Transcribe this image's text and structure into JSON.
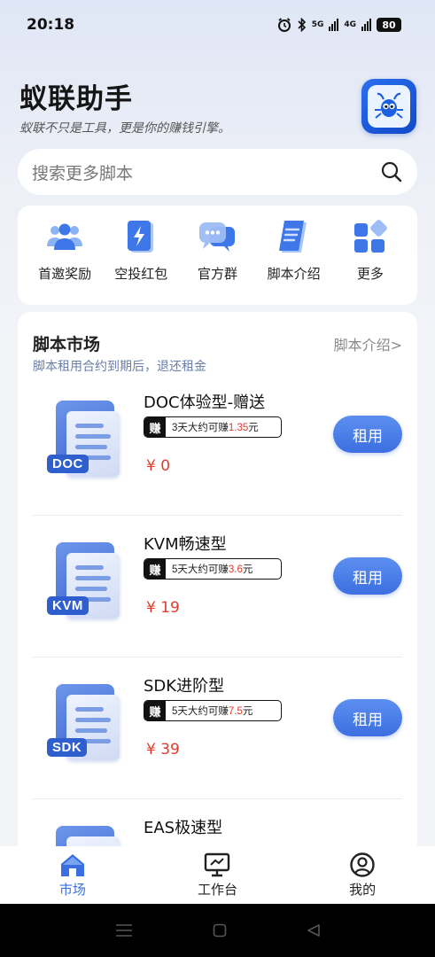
{
  "status_bar": {
    "time": "20:18",
    "network_1": "5G",
    "network_2": "4G",
    "battery": "80"
  },
  "header": {
    "title": "蚁联助手",
    "subtitle": "蚁联不只是工具，更是你的赚钱引擎。",
    "logo_icon": "ant-logo-icon"
  },
  "search": {
    "placeholder": "搜索更多脚本"
  },
  "quick_menu": [
    {
      "label": "首邀奖励",
      "icon": "invite-users-icon"
    },
    {
      "label": "空投红包",
      "icon": "lightning-packet-icon"
    },
    {
      "label": "官方群",
      "icon": "chat-group-icon"
    },
    {
      "label": "脚本介绍",
      "icon": "document-icon"
    },
    {
      "label": "更多",
      "icon": "grid-more-icon"
    }
  ],
  "market": {
    "title": "脚本市场",
    "link": "脚本介绍>",
    "subtitle": "脚本租用合约到期后，退还租金",
    "items": [
      {
        "tag": "DOC",
        "name": "DOC体验型-赠送",
        "earn_badge": "赚",
        "earn_prefix": "3天大约可赚",
        "earn_amount": "1.35",
        "earn_suffix": "元",
        "price": "¥ 0",
        "action": "租用"
      },
      {
        "tag": "KVM",
        "name": "KVM畅速型",
        "earn_badge": "赚",
        "earn_prefix": "5天大约可赚",
        "earn_amount": "3.6",
        "earn_suffix": "元",
        "price": "¥ 19",
        "action": "租用"
      },
      {
        "tag": "SDK",
        "name": "SDK进阶型",
        "earn_badge": "赚",
        "earn_prefix": "5天大约可赚",
        "earn_amount": "7.5",
        "earn_suffix": "元",
        "price": "¥ 39",
        "action": "租用"
      },
      {
        "tag": "",
        "name": "EAS极速型"
      }
    ]
  },
  "bottom_nav": [
    {
      "label": "市场",
      "icon": "home-icon",
      "active": true
    },
    {
      "label": "工作台",
      "icon": "monitor-icon",
      "active": false
    },
    {
      "label": "我的",
      "icon": "user-profile-icon",
      "active": false
    }
  ],
  "colors": {
    "accent": "#3c6fe0",
    "price": "#e23a2e"
  }
}
